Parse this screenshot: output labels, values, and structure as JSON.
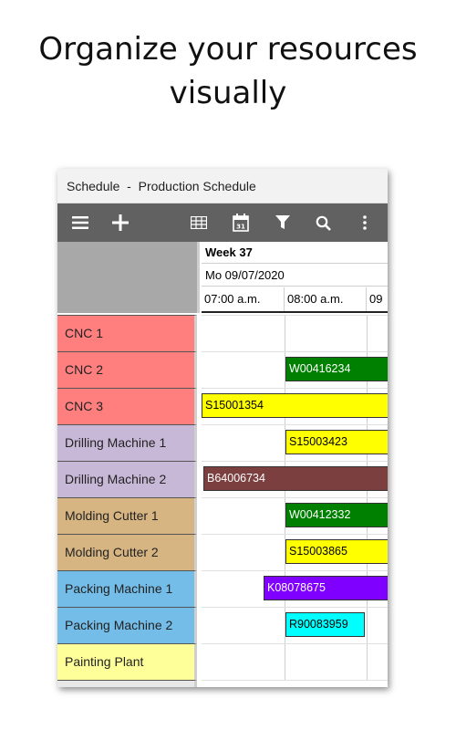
{
  "headline": {
    "line1": "Organize your resources",
    "line2": "visually"
  },
  "app": {
    "title": "Schedule  -  Production Schedule",
    "toolbar": {
      "icons": [
        "menu-icon",
        "add-icon",
        "grid-view-icon",
        "calendar-icon",
        "filter-icon",
        "search-icon",
        "more-icon"
      ]
    },
    "header": {
      "week": "Week 37",
      "day": "Mo 09/07/2020",
      "hours": [
        "07:00 a.m.",
        "08:00 a.m.",
        "09"
      ]
    },
    "rows": [
      {
        "resource": "CNC 1",
        "color": "#ff7f7f",
        "bar": null
      },
      {
        "resource": "CNC 2",
        "color": "#ff7f7f",
        "bar": {
          "label": "W00416234",
          "fill": "#008000",
          "text_color": "#ffffff"
        }
      },
      {
        "resource": "CNC 3",
        "color": "#ff7f7f",
        "bar": {
          "label": "S15001354",
          "fill": "#ffff00",
          "text_color": "#000000"
        }
      },
      {
        "resource": "Drilling Machine 1",
        "color": "#c8b8d8",
        "bar": {
          "label": "S15003423",
          "fill": "#ffff00",
          "text_color": "#000000"
        }
      },
      {
        "resource": "Drilling Machine 2",
        "color": "#c8b8d8",
        "bar": {
          "label": "B64006734",
          "fill": "#7b3f3f",
          "text_color": "#ffffff"
        }
      },
      {
        "resource": "Molding Cutter 1",
        "color": "#d6b583",
        "bar": {
          "label": "W00412332",
          "fill": "#008000",
          "text_color": "#ffffff"
        }
      },
      {
        "resource": "Molding Cutter 2",
        "color": "#d6b583",
        "bar": {
          "label": "S15003865",
          "fill": "#ffff00",
          "text_color": "#000000"
        }
      },
      {
        "resource": "Packing Machine 1",
        "color": "#74bde8",
        "bar": {
          "label": "K08078675",
          "fill": "#8000ff",
          "text_color": "#ffffff"
        }
      },
      {
        "resource": "Packing Machine 2",
        "color": "#74bde8",
        "bar": {
          "label": "R90083959",
          "fill": "#00ffff",
          "text_color": "#000000"
        }
      },
      {
        "resource": "Painting Plant",
        "color": "#ffff99",
        "bar": null
      }
    ]
  }
}
